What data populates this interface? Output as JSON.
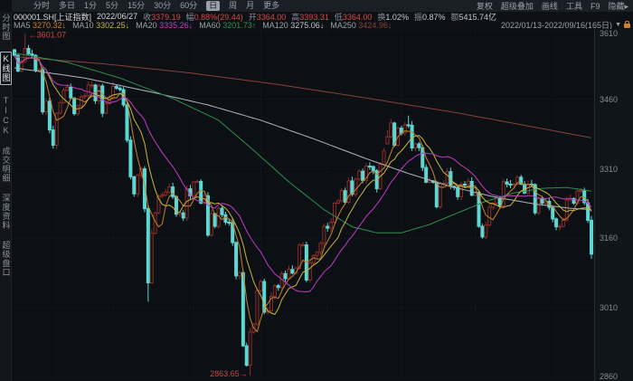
{
  "topbar": {
    "tabs": [
      {
        "label": "分时",
        "selected": false
      },
      {
        "label": "多日",
        "selected": false
      },
      {
        "label": "1分",
        "selected": false
      },
      {
        "label": "5分",
        "selected": false
      },
      {
        "label": "15分",
        "selected": false
      },
      {
        "label": "30分",
        "selected": false
      },
      {
        "label": "60分",
        "selected": false
      },
      {
        "label": "日",
        "selected": true
      },
      {
        "label": "周",
        "selected": false
      },
      {
        "label": "月",
        "selected": false
      },
      {
        "label": "更多",
        "selected": false
      }
    ],
    "menu": [
      "复权",
      "超级叠加",
      "画线",
      "工具",
      "F9",
      "隐藏▸"
    ]
  },
  "info_bar": {
    "symbol": "000001.SH[上证指数]",
    "date": "2022/06/27",
    "fields": [
      {
        "label": "收",
        "value": "3379.19",
        "tone": "up"
      },
      {
        "label": "幅",
        "value": "0.88%(29.44)",
        "tone": "up"
      },
      {
        "label": "开",
        "value": "3364.00",
        "tone": "up"
      },
      {
        "label": "高",
        "value": "3393.31",
        "tone": "up"
      },
      {
        "label": "低",
        "value": "3364.00",
        "tone": "up"
      },
      {
        "label": "换",
        "value": "1.02%",
        "tone": "plain"
      },
      {
        "label": "振",
        "value": "0.87%",
        "tone": "plain"
      },
      {
        "label": "额",
        "value": "5415.74亿",
        "tone": "plain"
      }
    ]
  },
  "ma_legend": [
    {
      "label": "MA5",
      "value": "3270.32",
      "arrow": "↓",
      "color": "#c8812c"
    },
    {
      "label": "MA10",
      "value": "3302.25",
      "arrow": "↓",
      "color": "#c9b53b"
    },
    {
      "label": "MA20",
      "value": "3335.26",
      "arrow": "↓",
      "color": "#c23ac2"
    },
    {
      "label": "MA60",
      "value": "3201.73",
      "arrow": "↑",
      "color": "#2f8f4e"
    },
    {
      "label": "MA120",
      "value": "3275.06",
      "arrow": "↓",
      "color": "#c2c8cd"
    },
    {
      "label": "MA250",
      "value": "3424.96",
      "arrow": "↓",
      "color": "#8a4038"
    }
  ],
  "range_selector": {
    "label": "2022/01/13-2022/09/16(165日)",
    "caret": "▼",
    "icon": "lock-icon"
  },
  "sidebar": {
    "items": [
      {
        "label": "分时图",
        "selected": false
      },
      {
        "label": "K线图",
        "selected": true
      },
      {
        "label": "TICK",
        "selected": false
      },
      {
        "label": "成交明细",
        "selected": false
      },
      {
        "label": "深度资料",
        "selected": false
      },
      {
        "label": "超级盘口",
        "selected": false
      }
    ]
  },
  "y_axis": {
    "ticks": [
      3610,
      3460,
      3310,
      3160,
      3010,
      2860
    ]
  },
  "annotations": {
    "high": {
      "label": "←3601.07",
      "index": 3,
      "price": 3601.07
    },
    "low": {
      "label": "2863.65→",
      "index": 67,
      "price": 2863.65
    }
  },
  "colors": {
    "up": "#8a2f27",
    "up_text": "#d24a43",
    "down": "#5bd8d4",
    "annotation": "#c94a44",
    "grid": "#1f252b",
    "grid_v": "#1a2026",
    "chart_bg": "#0c1015"
  },
  "chart_data": {
    "type": "candlestick",
    "title": "上证指数 000001.SH 日K线",
    "date_range": "2022/01/13-2022/09/16",
    "days": 165,
    "price_axis": {
      "min": 2860,
      "max": 3610,
      "ticks": [
        3610,
        3460,
        3310,
        3160,
        3010,
        2860
      ]
    },
    "period_high": 3601.07,
    "period_low": 2863.65,
    "first_open": 3567,
    "closes": [
      3555,
      3521,
      3542,
      3570,
      3558,
      3555,
      3523,
      3524,
      3433,
      3456,
      3394,
      3361,
      3430,
      3453,
      3480,
      3486,
      3463,
      3429,
      3446,
      3466,
      3468,
      3491,
      3491,
      3457,
      3489,
      3430,
      3451,
      3462,
      3488,
      3484,
      3481,
      3448,
      3372,
      3293,
      3256,
      3296,
      3310,
      3224,
      3064,
      3171,
      3215,
      3251,
      3254,
      3260,
      3271,
      3250,
      3212,
      3215,
      3204,
      3267,
      3252,
      3282,
      3283,
      3236,
      3252,
      3167,
      3213,
      3186,
      3225,
      3211,
      3195,
      3194,
      3151,
      3079,
      3086,
      2928,
      2886,
      2958,
      2975,
      3047,
      3067,
      3001,
      3004,
      3035,
      3058,
      3054,
      3084,
      3073,
      3093,
      3085,
      3096,
      3146,
      3146,
      3070,
      3107,
      3123,
      3130,
      3149,
      3186,
      3182,
      3195,
      3236,
      3241,
      3263,
      3238,
      3284,
      3255,
      3288,
      3305,
      3285,
      3316,
      3315,
      3306,
      3267,
      3320,
      3349,
      3379.19,
      3409,
      3361,
      3398,
      3387,
      3405,
      3404,
      3355,
      3364,
      3356,
      3313,
      3281,
      3284,
      3281,
      3228,
      3278,
      3279,
      3304,
      3272,
      3270,
      3250,
      3277,
      3276,
      3283,
      3253,
      3259,
      3186,
      3163,
      3189,
      3227,
      3236,
      3247,
      3230,
      3282,
      3277,
      3276,
      3277,
      3292,
      3277,
      3258,
      3277,
      3276,
      3215,
      3246,
      3236,
      3240,
      3227,
      3202,
      3185,
      3186,
      3199,
      3243,
      3246,
      3236,
      3262,
      3263,
      3237,
      3199,
      3126
    ],
    "overrides": {
      "3": {
        "high": 3601.07
      },
      "38": {
        "low": 3023.3
      },
      "67": {
        "low": 2863.65
      },
      "106": {
        "open": 3364.0,
        "high": 3393.31,
        "low": 3364.0,
        "close": 3379.19
      },
      "112": {
        "high": 3424.89
      },
      "164": {
        "low": 3115.9
      }
    },
    "month_start_indices": [
      12,
      28,
      51,
      70,
      89,
      110,
      131,
      154
    ],
    "ma_computed": [
      {
        "name": "MA5",
        "window": 5,
        "color": "#c8812c"
      },
      {
        "name": "MA10",
        "window": 10,
        "color": "#c9b53b"
      },
      {
        "name": "MA20",
        "window": 20,
        "color": "#c23ac2"
      }
    ],
    "ma_overlays": [
      {
        "name": "MA250",
        "color": "#84423a",
        "points": [
          [
            0,
            3552
          ],
          [
            25,
            3537
          ],
          [
            50,
            3517
          ],
          [
            75,
            3492
          ],
          [
            100,
            3463
          ],
          [
            125,
            3432
          ],
          [
            145,
            3404
          ],
          [
            164,
            3377
          ]
        ]
      },
      {
        "name": "MA120",
        "color": "#aeb6bc",
        "points": [
          [
            0,
            3528
          ],
          [
            20,
            3506
          ],
          [
            40,
            3474
          ],
          [
            55,
            3448
          ],
          [
            70,
            3415
          ],
          [
            85,
            3375
          ],
          [
            100,
            3332
          ],
          [
            112,
            3300
          ],
          [
            124,
            3272
          ],
          [
            136,
            3250
          ],
          [
            148,
            3234
          ],
          [
            158,
            3225
          ],
          [
            164,
            3222
          ]
        ]
      },
      {
        "name": "MA60",
        "color": "#2f8f4e",
        "points": [
          [
            0,
            3560
          ],
          [
            15,
            3540
          ],
          [
            30,
            3506
          ],
          [
            45,
            3462
          ],
          [
            58,
            3415
          ],
          [
            68,
            3350
          ],
          [
            78,
            3282
          ],
          [
            88,
            3222
          ],
          [
            96,
            3185
          ],
          [
            103,
            3172
          ],
          [
            110,
            3172
          ],
          [
            118,
            3190
          ],
          [
            126,
            3215
          ],
          [
            134,
            3240
          ],
          [
            142,
            3258
          ],
          [
            150,
            3268
          ],
          [
            157,
            3270
          ],
          [
            164,
            3262
          ]
        ]
      }
    ]
  }
}
